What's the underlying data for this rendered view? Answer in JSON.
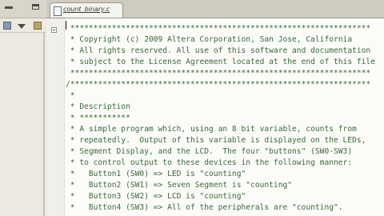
{
  "editor": {
    "tab_label": "count_binary.c",
    "colors": {
      "comment": "#3b6a3b",
      "background": "#fbfbf8"
    },
    "lines": [
      " *****************************************************************",
      " * Copyright (c) 2009 Altera Corporation, San Jose, California",
      " * All rights reserved. All use of this software and documentation",
      " * subject to the License Agreement located at the end of this file",
      " *****************************************************************",
      "/*****************************************************************",
      " *",
      " * Description",
      " * ***********",
      " * A simple program which, using an 8 bit variable, counts from",
      " * repeatedly.  Output of this variable is displayed on the LEDs,",
      " * Segment Display, and the LCD.  The four \"buttons\" (SW0-SW3)",
      " * to control output to these devices in the following manner:",
      " *   Button1 (SW0) => LED is \"counting\"",
      " *   Button2 (SW1) => Seven Segment is \"counting\"",
      " *   Button3 (SW2) => LCD is \"counting\"",
      " *   Button4 (SW3) => All of the peripherals are \"counting\"."
    ]
  },
  "left_panel": {
    "icons": [
      "minimize-icon",
      "maximize-icon",
      "collapse-all-icon",
      "menu-chevron-icon",
      "link-icon"
    ]
  }
}
